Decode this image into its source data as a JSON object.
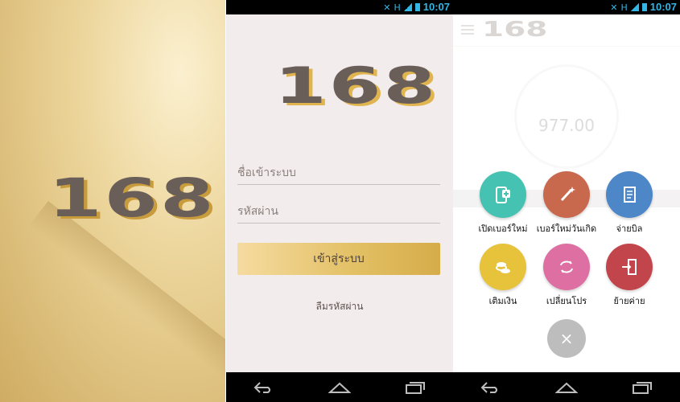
{
  "splash": {
    "logo": "168"
  },
  "status": {
    "time": "10:07",
    "network": "H"
  },
  "login": {
    "logo": "168",
    "username_placeholder": "ชื่อเข้าระบบ",
    "password_placeholder": "รหัสผ่าน",
    "login_button": "เข้าสู่ระบบ",
    "forgot_link": "ลืมรหัสผ่าน"
  },
  "menu_background": {
    "logo": "168",
    "balance": "977.00"
  },
  "fab_menu": {
    "items": [
      {
        "label": "เปิดเบอร์ใหม่",
        "color": "#45c2b1",
        "icon": "new-sim-icon"
      },
      {
        "label": "เบอร์ใหม่วันเกิด",
        "color": "#c8694d",
        "icon": "magic-wand-icon"
      },
      {
        "label": "จ่ายบิล",
        "color": "#4d87c7",
        "icon": "bill-icon"
      },
      {
        "label": "เติมเงิน",
        "color": "#e7c23b",
        "icon": "coins-icon"
      },
      {
        "label": "เปลี่ยนโปร",
        "color": "#de6fa3",
        "icon": "swap-icon"
      },
      {
        "label": "ย้ายค่าย",
        "color": "#c2454c",
        "icon": "move-network-icon"
      }
    ],
    "close_symbol": "×"
  }
}
